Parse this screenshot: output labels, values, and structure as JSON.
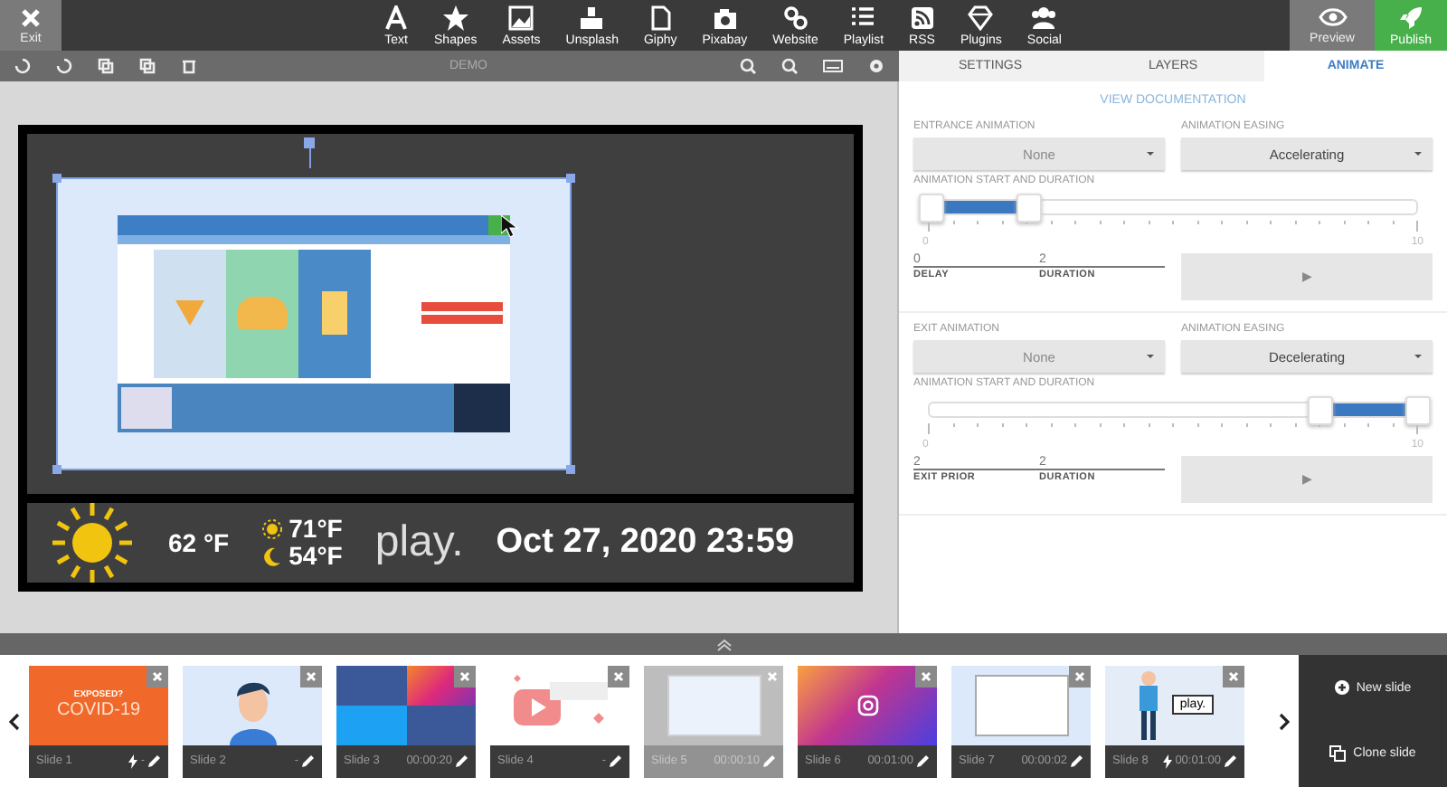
{
  "topbar": {
    "exit": "Exit",
    "tools": [
      {
        "label": "Text"
      },
      {
        "label": "Shapes"
      },
      {
        "label": "Assets"
      },
      {
        "label": "Unsplash"
      },
      {
        "label": "Giphy"
      },
      {
        "label": "Pixabay"
      },
      {
        "label": "Website"
      },
      {
        "label": "Playlist"
      },
      {
        "label": "RSS"
      },
      {
        "label": "Plugins"
      },
      {
        "label": "Social"
      }
    ],
    "preview": "Preview",
    "publish": "Publish"
  },
  "editor": {
    "title": "DEMO"
  },
  "stage": {
    "widget": {
      "temperature": "62 °F",
      "high": "71°F",
      "low": "54°F",
      "logo": "play.",
      "datetime": "Oct 27, 2020 23:59"
    }
  },
  "panel": {
    "tabs": [
      {
        "label": "SETTINGS",
        "selected": false
      },
      {
        "label": "LAYERS",
        "selected": false
      },
      {
        "label": "ANIMATE",
        "selected": true
      }
    ],
    "doc_link": "VIEW DOCUMENTATION",
    "sections": [
      {
        "animation_label": "ENTRANCE ANIMATION",
        "animation_value": "None",
        "easing_label": "ANIMATION EASING",
        "easing_value": "Accelerating",
        "range_label": "ANIMATION START AND DURATION",
        "thumbs": [
          {
            "level": 0
          },
          {
            "level": 0.2
          }
        ],
        "min": "0",
        "max": "10",
        "first_value": "0",
        "first_label": "DELAY",
        "second_value": "2",
        "second_label": "DURATION",
        "play": "▶"
      },
      {
        "animation_label": "EXIT ANIMATION",
        "animation_value": "None",
        "easing_label": "ANIMATION EASING",
        "easing_value": "Decelerating",
        "range_label": "ANIMATION START AND DURATION",
        "thumbs": [
          {
            "level": 0.8
          },
          {
            "level": 1
          }
        ],
        "min": "0",
        "max": "10",
        "first_value": "2",
        "first_label": "EXIT PRIOR",
        "second_value": "2",
        "second_label": "DURATION",
        "play": "▶"
      }
    ]
  },
  "slides": [
    {
      "label": "Slide 1",
      "duration": "-",
      "bolt": true,
      "selected": false,
      "kind": "covid",
      "thumb_lines": [
        "EXPOSED?",
        "COVID-19"
      ]
    },
    {
      "label": "Slide 2",
      "duration": "-",
      "bolt": false,
      "selected": false,
      "kind": "avatar"
    },
    {
      "label": "Slide 3",
      "duration": "00:00:20",
      "bolt": false,
      "selected": false,
      "kind": "social"
    },
    {
      "label": "Slide 4",
      "duration": "-",
      "bolt": false,
      "selected": false,
      "kind": "video"
    },
    {
      "label": "Slide 5",
      "duration": "00:00:10",
      "bolt": false,
      "selected": true,
      "kind": "screen"
    },
    {
      "label": "Slide 6",
      "duration": "00:01:00",
      "bolt": false,
      "selected": false,
      "kind": "gradient"
    },
    {
      "label": "Slide 7",
      "duration": "00:00:02",
      "bolt": false,
      "selected": false,
      "kind": "screens"
    },
    {
      "label": "Slide 8",
      "duration": "00:01:00",
      "bolt": true,
      "selected": false,
      "kind": "presenter",
      "thumb_lines": [
        "play."
      ]
    }
  ],
  "slide_actions": [
    "New slide",
    "Clone slide"
  ]
}
